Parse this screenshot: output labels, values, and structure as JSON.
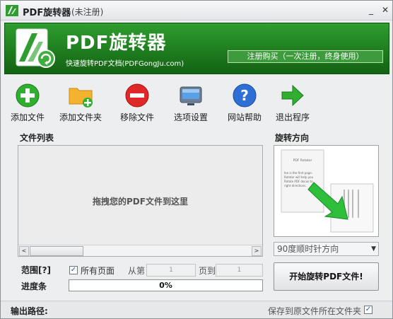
{
  "titlebar": {
    "title": "PDF旋转器",
    "subtitle": "(未注册)",
    "minimize": "_",
    "close": "✕"
  },
  "banner": {
    "brand": "PDF旋转器",
    "tagline": "快速旋转PDF文档(PDFGongJu.com)",
    "register": "注册购买（一次注册，终身使用）",
    "brand_color": "#1d7a1d"
  },
  "toolbar": [
    {
      "label": "添加文件",
      "icon": "add-file-icon"
    },
    {
      "label": "添加文件夹",
      "icon": "add-folder-icon"
    },
    {
      "label": "移除文件",
      "icon": "remove-file-icon"
    },
    {
      "label": "选项设置",
      "icon": "settings-icon"
    },
    {
      "label": "网站帮助",
      "icon": "help-icon"
    },
    {
      "label": "退出程序",
      "icon": "exit-icon"
    }
  ],
  "filelist": {
    "title": "文件列表",
    "hint": "拖拽您的PDF文件到这里",
    "scroll_left": "<",
    "scroll_right": ">"
  },
  "rotation": {
    "title": "旋转方向",
    "selected": "90度顺时针方向",
    "preview_caption": "PDF Rotator",
    "preview_lines": [
      "Iee is the first page.",
      "Rotator will help you",
      "Rotate PDF docus to",
      "right directions."
    ]
  },
  "range": {
    "label": "范围[?]",
    "all_pages": "所有页面",
    "all_pages_checked": true,
    "from": "从第",
    "from_value": "1",
    "to": "页到",
    "to_value": "1"
  },
  "progress": {
    "label": "进度条",
    "value_text": "0%",
    "value": 0
  },
  "start_button": "开始旋转PDF文件!",
  "bottom": {
    "output_label": "输出路径:",
    "save_same": "保存到原文件所在文件夹",
    "save_same_checked": true
  }
}
